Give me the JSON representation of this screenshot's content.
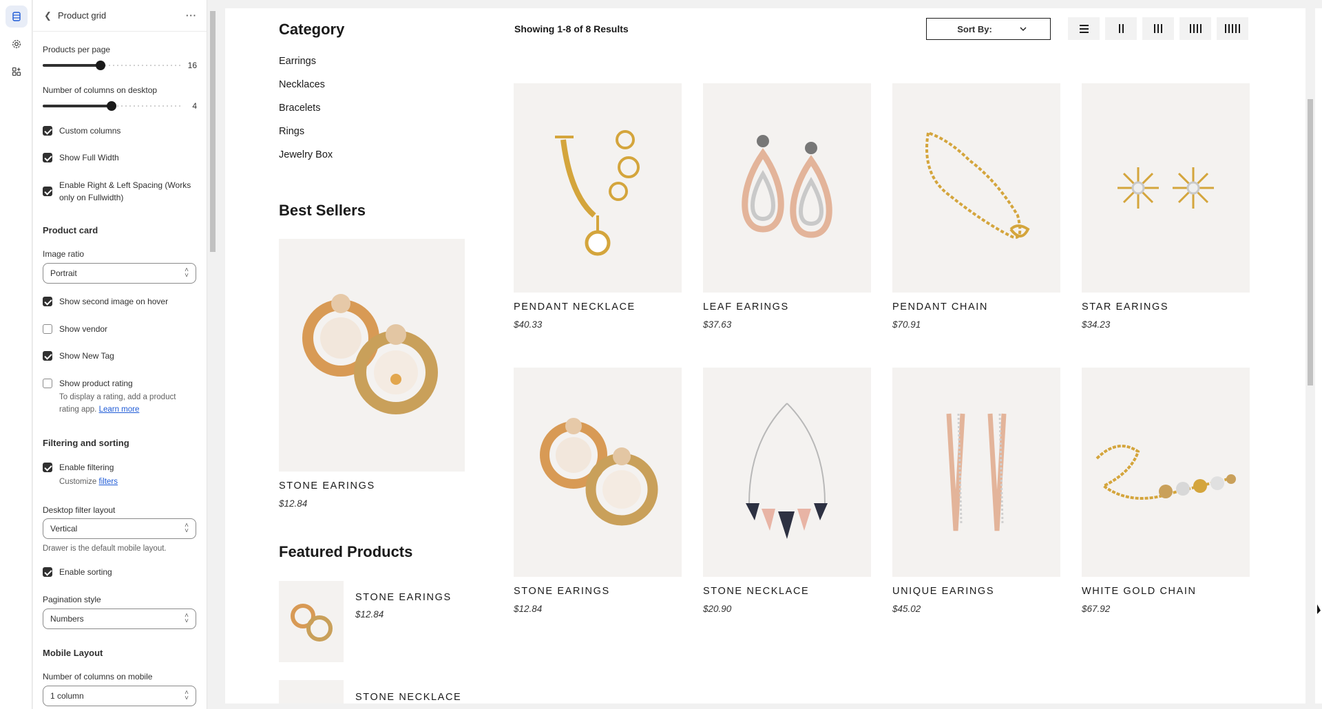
{
  "sidebar": {
    "title": "Product grid",
    "products_per_page_label": "Products per page",
    "products_per_page_value": "16",
    "products_per_page_fraction": 0.42,
    "columns_desktop_label": "Number of columns on desktop",
    "columns_desktop_value": "4",
    "columns_desktop_fraction": 0.5,
    "custom_columns": "Custom columns",
    "show_full_width": "Show Full Width",
    "enable_spacing": "Enable Right & Left Spacing (Works only on Fullwidth)",
    "product_card_heading": "Product card",
    "image_ratio_label": "Image ratio",
    "image_ratio_value": "Portrait",
    "show_second_image": "Show second image on hover",
    "show_vendor": "Show vendor",
    "show_new_tag": "Show New Tag",
    "show_product_rating": "Show product rating",
    "rating_note": "To display a rating, add a product rating app.",
    "learn_more": "Learn more",
    "filtering_heading": "Filtering and sorting",
    "enable_filtering": "Enable filtering",
    "customize": "Customize",
    "filters_link": "filters",
    "desktop_filter_layout_label": "Desktop filter layout",
    "desktop_filter_layout_value": "Vertical",
    "drawer_note": "Drawer is the default mobile layout.",
    "enable_sorting": "Enable sorting",
    "pagination_style_label": "Pagination style",
    "pagination_style_value": "Numbers",
    "mobile_layout_heading": "Mobile Layout",
    "columns_mobile_label": "Number of columns on mobile",
    "columns_mobile_value": "1 column"
  },
  "store": {
    "category_title": "Category",
    "categories": [
      "Earrings",
      "Necklaces",
      "Bracelets",
      "Rings",
      "Jewelry Box"
    ],
    "best_sellers_title": "Best Sellers",
    "best_seller": {
      "name": "STONE EARINGS",
      "price": "$12.84"
    },
    "featured_title": "Featured Products",
    "featured": [
      {
        "name": "STONE EARINGS",
        "price": "$12.84"
      },
      {
        "name": "STONE NECKLACE",
        "price": ""
      }
    ],
    "showing": "Showing 1-8 of 8 Results",
    "sort_label": "Sort By:",
    "products": [
      {
        "name": "PENDANT NECKLACE",
        "price": "$40.33"
      },
      {
        "name": "LEAF EARINGS",
        "price": "$37.63"
      },
      {
        "name": "PENDANT CHAIN",
        "price": "$70.91"
      },
      {
        "name": "STAR EARINGS",
        "price": "$34.23"
      },
      {
        "name": "STONE EARINGS",
        "price": "$12.84"
      },
      {
        "name": "STONE NECKLACE",
        "price": "$20.90"
      },
      {
        "name": "UNIQUE EARINGS",
        "price": "$45.02"
      },
      {
        "name": "WHITE GOLD CHAIN",
        "price": "$67.92"
      }
    ]
  },
  "colors": {
    "accent": "#1f5bd6",
    "gold": "#d4a53c",
    "rose": "#e3b49a"
  }
}
